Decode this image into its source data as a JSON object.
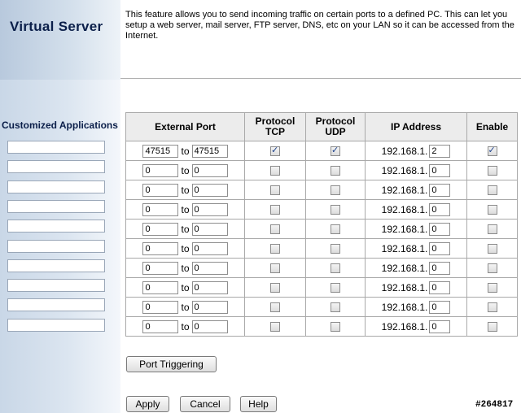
{
  "page": {
    "title": "Virtual Server",
    "description": "This feature allows you to send incoming traffic on certain ports to a defined PC. This can let you setup a web server, mail server, FTP server, DNS, etc on your LAN so it can be accessed from the Internet."
  },
  "custom_apps": {
    "heading": "Customized Applications",
    "values": [
      "",
      "",
      "",
      "",
      "",
      "",
      "",
      "",
      "",
      ""
    ]
  },
  "table": {
    "headers": {
      "external_port": "External Port",
      "tcp": "Protocol TCP",
      "tcp_line1": "Protocol",
      "tcp_line2": "TCP",
      "udp_line1": "Protocol",
      "udp_line2": "UDP",
      "ip": "IP Address",
      "enable": "Enable"
    },
    "to_label": "to",
    "ip_prefix": "192.168.1.",
    "rows": [
      {
        "start": "47515",
        "end": "47515",
        "tcp": true,
        "udp": true,
        "ip_last": "2",
        "enable": true
      },
      {
        "start": "0",
        "end": "0",
        "tcp": false,
        "udp": false,
        "ip_last": "0",
        "enable": false
      },
      {
        "start": "0",
        "end": "0",
        "tcp": false,
        "udp": false,
        "ip_last": "0",
        "enable": false
      },
      {
        "start": "0",
        "end": "0",
        "tcp": false,
        "udp": false,
        "ip_last": "0",
        "enable": false
      },
      {
        "start": "0",
        "end": "0",
        "tcp": false,
        "udp": false,
        "ip_last": "0",
        "enable": false
      },
      {
        "start": "0",
        "end": "0",
        "tcp": false,
        "udp": false,
        "ip_last": "0",
        "enable": false
      },
      {
        "start": "0",
        "end": "0",
        "tcp": false,
        "udp": false,
        "ip_last": "0",
        "enable": false
      },
      {
        "start": "0",
        "end": "0",
        "tcp": false,
        "udp": false,
        "ip_last": "0",
        "enable": false
      },
      {
        "start": "0",
        "end": "0",
        "tcp": false,
        "udp": false,
        "ip_last": "0",
        "enable": false
      },
      {
        "start": "0",
        "end": "0",
        "tcp": false,
        "udp": false,
        "ip_last": "0",
        "enable": false
      }
    ]
  },
  "buttons": {
    "port_triggering": "Port Triggering",
    "apply": "Apply",
    "cancel": "Cancel",
    "help": "Help"
  },
  "watermark": "#264817",
  "colors": {
    "title": "#0b1f4a",
    "panel": "#c9d7e7",
    "check": "#1a3f8a"
  }
}
